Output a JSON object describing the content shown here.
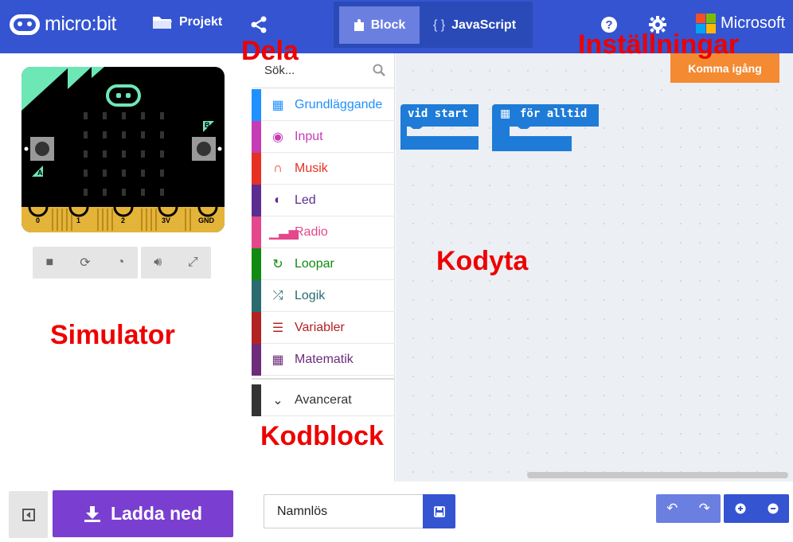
{
  "header": {
    "brand": "micro:bit",
    "project_label": "Projekt",
    "blocks_tab": "Block",
    "javascript_tab": "JavaScript",
    "microsoft": "Microsoft",
    "colors": {
      "bar": "#3454d1",
      "toggle_bg": "#2a4ab8",
      "active_tab": "#6b7fe0"
    }
  },
  "simulator": {
    "pins": [
      "0",
      "1",
      "2",
      "3V",
      "GND"
    ],
    "button_a": "A",
    "button_b": "B",
    "controls": [
      "stop-icon",
      "restart-icon",
      "slowmo-icon",
      "sound-icon",
      "fullscreen-icon"
    ]
  },
  "toolbox": {
    "search_placeholder": "Sök...",
    "categories": [
      {
        "label": "Grundläggande",
        "color": "#1e90ff",
        "icon": "grid-icon"
      },
      {
        "label": "Input",
        "color": "#d400d4",
        "icon": "target-icon"
      },
      {
        "label": "Musik",
        "color": "#e63022",
        "icon": "headphones-icon"
      },
      {
        "label": "Led",
        "color": "#5c2d91",
        "icon": "toggle-icon"
      },
      {
        "label": "Radio",
        "color": "#e3008c",
        "icon": "signal-icon"
      },
      {
        "label": "Loopar",
        "color": "#00aa00",
        "icon": "refresh-icon"
      },
      {
        "label": "Logik",
        "color": "#00a4a6",
        "icon": "shuffle-icon"
      },
      {
        "label": "Variabler",
        "color": "#dc143c",
        "icon": "list-icon"
      },
      {
        "label": "Matematik",
        "color": "#9400d3",
        "icon": "calculator-icon"
      }
    ],
    "advanced_label": "Avancerat"
  },
  "workspace": {
    "getting_started": "Komma igång",
    "block_on_start": "vid start",
    "block_forever": "för alltid"
  },
  "bottom": {
    "download_label": "Ladda ned",
    "project_name": "Namnlös"
  },
  "annotations": {
    "share": "Dela",
    "settings": "Inställningar",
    "simulator": "Simulator",
    "workspace": "Kodyta",
    "blocks": "Kodblock"
  }
}
